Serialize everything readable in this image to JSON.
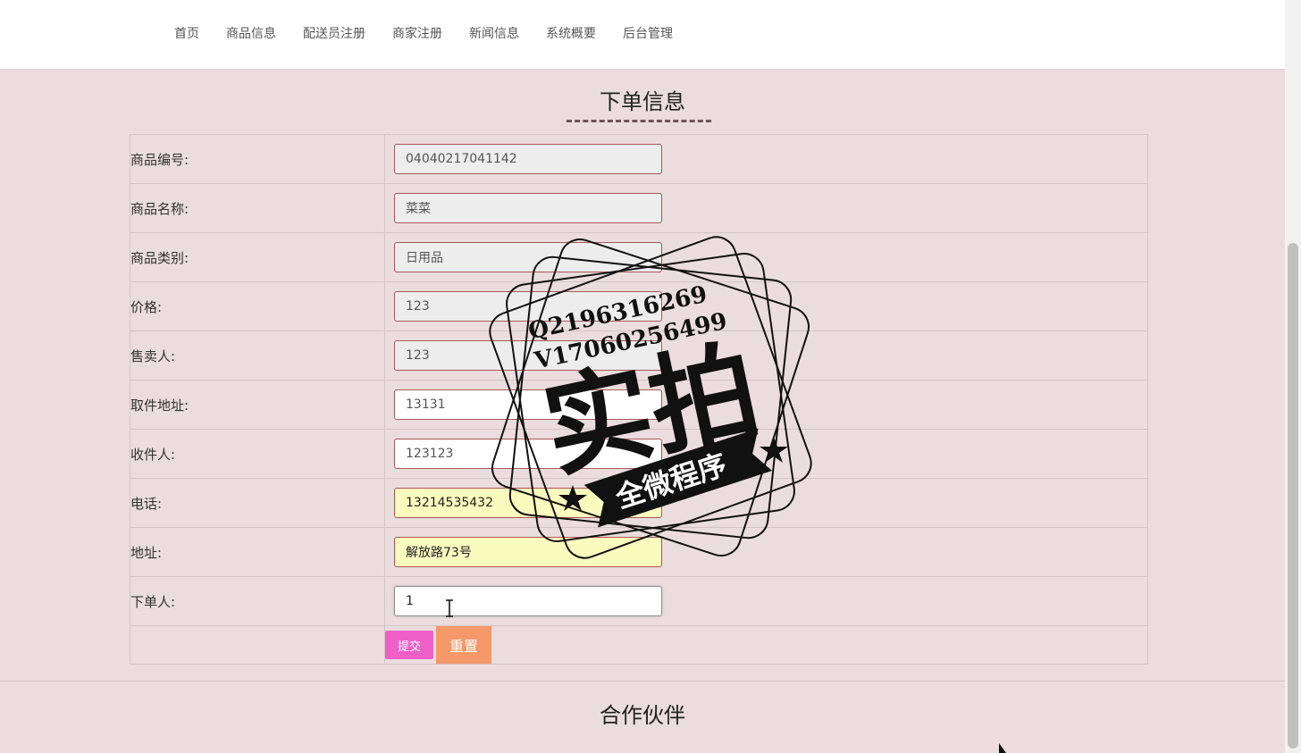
{
  "nav": {
    "items": [
      {
        "label": "首页"
      },
      {
        "label": "商品信息"
      },
      {
        "label": "配送员注册"
      },
      {
        "label": "商家注册"
      },
      {
        "label": "新闻信息"
      },
      {
        "label": "系统概要"
      },
      {
        "label": "后台管理"
      }
    ]
  },
  "order": {
    "title": "下单信息",
    "fields": [
      {
        "label": "商品编号:",
        "value": "04040217041142"
      },
      {
        "label": "商品名称:",
        "value": "菜菜"
      },
      {
        "label": "商品类别:",
        "value": "日用品"
      },
      {
        "label": "价格:",
        "value": "123"
      },
      {
        "label": "售卖人:",
        "value": "123"
      },
      {
        "label": "取件地址:",
        "value": "13131"
      },
      {
        "label": "收件人:",
        "value": "123123"
      },
      {
        "label": "电话:",
        "value": "13214535432"
      },
      {
        "label": "地址:",
        "value": "解放路73号"
      },
      {
        "label": "下单人:",
        "value": "1"
      }
    ],
    "submit_label": "提交",
    "reset_label": "重置"
  },
  "partners": {
    "title": "合作伙伴"
  },
  "watermark": {
    "line1": "Q2196316269",
    "line2": "V17060256499",
    "big_text": "实拍",
    "ribbon_text": "全微程序"
  },
  "colors": {
    "background": "#ebdcdd",
    "submit": "#ee5fc8",
    "reset": "#f5986a",
    "field_border": "#a8575a",
    "autofill": "#fbfbbe"
  }
}
